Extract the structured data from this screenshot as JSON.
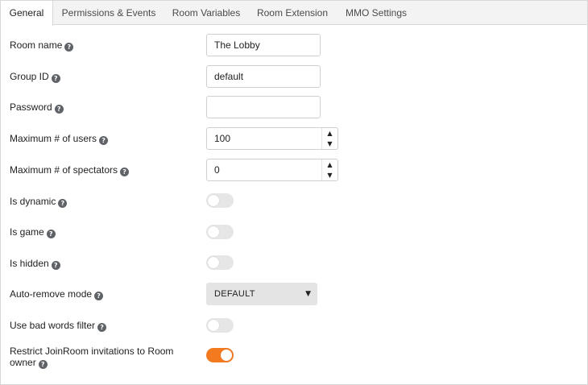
{
  "tabs": [
    {
      "label": "General",
      "active": true
    },
    {
      "label": "Permissions & Events",
      "active": false
    },
    {
      "label": "Room Variables",
      "active": false
    },
    {
      "label": "Room Extension",
      "active": false
    },
    {
      "label": "MMO Settings",
      "active": false
    }
  ],
  "fields": {
    "room_name": {
      "label": "Room name",
      "value": "The Lobby"
    },
    "group_id": {
      "label": "Group ID",
      "value": "default"
    },
    "password": {
      "label": "Password",
      "value": ""
    },
    "max_users": {
      "label": "Maximum # of users",
      "value": "100"
    },
    "max_spectators": {
      "label": "Maximum # of spectators",
      "value": "0"
    },
    "is_dynamic": {
      "label": "Is dynamic",
      "enabled": false
    },
    "is_game": {
      "label": "Is game",
      "enabled": false
    },
    "is_hidden": {
      "label": "Is hidden",
      "enabled": false
    },
    "auto_remove_mode": {
      "label": "Auto-remove mode",
      "value": "DEFAULT"
    },
    "bad_words_filter": {
      "label": "Use bad words filter",
      "enabled": false
    },
    "restrict_joinroom": {
      "label_line1": "Restrict JoinRoom invitations to Room",
      "label_line2": "owner",
      "enabled": true
    }
  },
  "icons": {
    "help": "question-circle-icon",
    "stepper_up": "caret-up-icon",
    "stepper_down": "caret-down-icon",
    "dropdown": "caret-down-icon"
  },
  "glyphs": {
    "help": "?",
    "up": "▲",
    "down": "▼",
    "caret": "▼"
  },
  "colors": {
    "toggle_on": "#f47a20",
    "toggle_off": "#e6e6e6",
    "tabbar_bg": "#f3f3f3",
    "select_bg": "#e4e4e4"
  }
}
